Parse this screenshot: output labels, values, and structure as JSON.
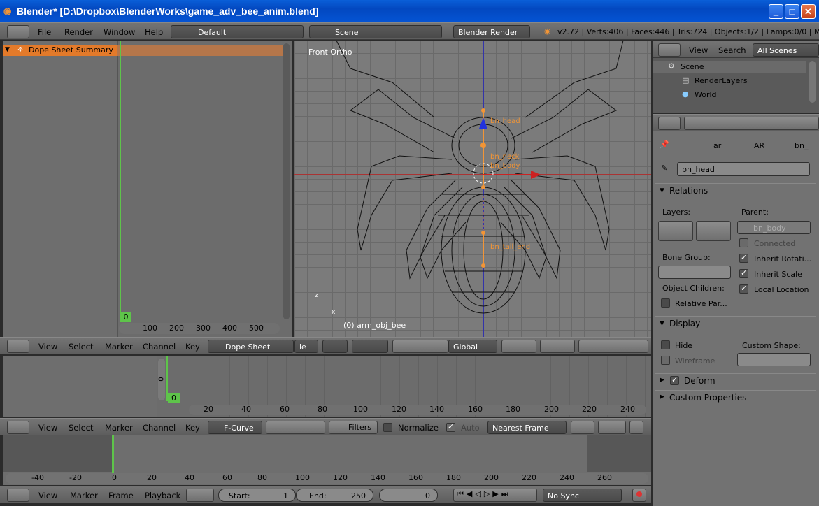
{
  "window": {
    "title": "Blender* [D:\\Dropbox\\BlenderWorks\\game_adv_bee_anim.blend]",
    "min": "_",
    "max": "□",
    "close": "✕"
  },
  "info": {
    "menus": [
      "File",
      "Render",
      "Window",
      "Help"
    ],
    "layout": "Default",
    "scene": "Scene",
    "engine": "Blender Render",
    "stats": "v2.72 | Verts:406 | Faces:446 | Tris:724 | Objects:1/2 | Lamps:0/0 | Mem"
  },
  "dopesheet": {
    "summary": "Dope Sheet Summary",
    "frame": "0",
    "ticks": [
      "100",
      "200",
      "300",
      "400",
      "500"
    ],
    "menus": [
      "View",
      "Select",
      "Marker",
      "Channel",
      "Key"
    ],
    "mode": "Dope Sheet"
  },
  "viewport": {
    "view_label": "Front Ortho",
    "object_label": "(0) arm_obj_bee",
    "bones": [
      "bn_head",
      "bn_neck",
      "bn_body",
      "bn_tail_end"
    ],
    "axis_z": "z",
    "axis_x": "x",
    "orientation": "Global",
    "mode_trunc": "le"
  },
  "outliner": {
    "menus": [
      "View",
      "Search"
    ],
    "filter": "All Scenes",
    "items": [
      "Scene",
      "RenderLayers",
      "World"
    ]
  },
  "properties": {
    "breadcrumb": [
      "ar",
      "AR",
      "bn_"
    ],
    "bone_name": "bn_head",
    "relations": "Relations",
    "layers_label": "Layers:",
    "parent_label": "Parent:",
    "parent_value": "bn_body",
    "connected": "Connected",
    "bone_group": "Bone Group:",
    "inherit_rotation": "Inherit Rotati...",
    "inherit_scale": "Inherit Scale",
    "object_children": "Object Children:",
    "local_location": "Local Location",
    "relative_parent": "Relative Par...",
    "display": "Display",
    "hide": "Hide",
    "custom_shape": "Custom Shape:",
    "wireframe": "Wireframe",
    "deform": "Deform",
    "custom_properties": "Custom Properties"
  },
  "graph": {
    "frame": "0",
    "y_label": "0",
    "ticks": [
      "20",
      "40",
      "60",
      "80",
      "100",
      "120",
      "140",
      "160",
      "180",
      "200",
      "220",
      "240"
    ],
    "menus": [
      "View",
      "Select",
      "Marker",
      "Channel",
      "Key"
    ],
    "mode": "F-Curve",
    "filters": "Filters",
    "normalize": "Normalize",
    "auto": "Auto",
    "snap": "Nearest Frame"
  },
  "timeline": {
    "ticks": [
      "-40",
      "-20",
      "0",
      "20",
      "40",
      "60",
      "80",
      "100",
      "120",
      "140",
      "160",
      "180",
      "200",
      "220",
      "240",
      "260"
    ],
    "menus": [
      "View",
      "Marker",
      "Frame",
      "Playback"
    ],
    "start_label": "Start:",
    "start_value": "1",
    "end_label": "End:",
    "end_value": "250",
    "current": "0",
    "sync": "No Sync"
  },
  "colors": {
    "accent": "#e4762a",
    "frame_marker": "#5ec44a",
    "titlebar": "#0550d0"
  }
}
